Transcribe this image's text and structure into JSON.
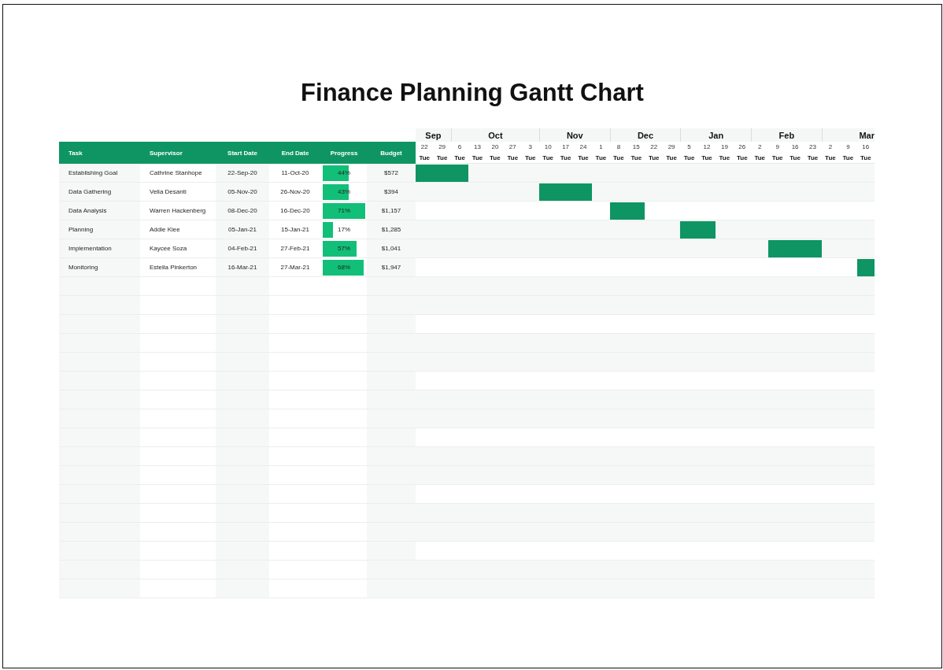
{
  "title": "Finance Planning Gantt Chart",
  "timeline": {
    "months": [
      {
        "label": "Sep",
        "weeks": [
          {
            "day": "22",
            "weekday": "Tue"
          },
          {
            "day": "29",
            "weekday": "Tue"
          }
        ]
      },
      {
        "label": "Oct",
        "weeks": [
          {
            "day": "6",
            "weekday": "Tue"
          },
          {
            "day": "13",
            "weekday": "Tue"
          },
          {
            "day": "20",
            "weekday": "Tue"
          },
          {
            "day": "27",
            "weekday": "Tue"
          },
          {
            "day": "3",
            "weekday": "Tue"
          }
        ]
      },
      {
        "label": "Nov",
        "weeks": [
          {
            "day": "10",
            "weekday": "Tue"
          },
          {
            "day": "17",
            "weekday": "Tue"
          },
          {
            "day": "24",
            "weekday": "Tue"
          },
          {
            "day": "1",
            "weekday": "Tue"
          }
        ]
      },
      {
        "label": "Dec",
        "weeks": [
          {
            "day": "8",
            "weekday": "Tue"
          },
          {
            "day": "15",
            "weekday": "Tue"
          },
          {
            "day": "22",
            "weekday": "Tue"
          },
          {
            "day": "29",
            "weekday": "Tue"
          }
        ]
      },
      {
        "label": "Jan",
        "weeks": [
          {
            "day": "5",
            "weekday": "Tue"
          },
          {
            "day": "12",
            "weekday": "Tue"
          },
          {
            "day": "19",
            "weekday": "Tue"
          },
          {
            "day": "26",
            "weekday": "Tue"
          }
        ]
      },
      {
        "label": "Feb",
        "weeks": [
          {
            "day": "2",
            "weekday": "Tue"
          },
          {
            "day": "9",
            "weekday": "Tue"
          },
          {
            "day": "16",
            "weekday": "Tue"
          },
          {
            "day": "23",
            "weekday": "Tue"
          }
        ]
      },
      {
        "label": "Mar",
        "weeks": [
          {
            "day": "2",
            "weekday": "Tue"
          },
          {
            "day": "9",
            "weekday": "Tue"
          },
          {
            "day": "16",
            "weekday": "Tue"
          }
        ]
      }
    ]
  },
  "table": {
    "columns": [
      "Task",
      "Supervisor",
      "Start Date",
      "End Date",
      "Progress",
      "Budget"
    ],
    "rows": [
      {
        "task": "Establishing Goal",
        "supervisor": "Cathrine Stanhope",
        "start_date": "22-Sep-20",
        "end_date": "11-Oct-20",
        "progress": {
          "label": "44%",
          "level": 0.62
        },
        "budget": "$572"
      },
      {
        "task": "Data Gathering",
        "supervisor": "Velia Desanti",
        "start_date": "05-Nov-20",
        "end_date": "26-Nov-20",
        "progress": {
          "label": "43%",
          "level": 0.61
        },
        "budget": "$394"
      },
      {
        "task": "Data Analysis",
        "supervisor": "Warren Hackenberg",
        "start_date": "08-Dec-20",
        "end_date": "16-Dec-20",
        "progress": {
          "label": "71%",
          "level": 1
        },
        "budget": "$1,157"
      },
      {
        "task": "Planning",
        "supervisor": "Addie Klee",
        "start_date": "05-Jan-21",
        "end_date": "15-Jan-21",
        "progress": {
          "label": "17%",
          "level": 0.24
        },
        "budget": "$1,285"
      },
      {
        "task": "Implementation",
        "supervisor": "Kaycee Soza",
        "start_date": "04-Feb-21",
        "end_date": "27-Feb-21",
        "progress": {
          "label": "57%",
          "level": 0.8
        },
        "budget": "$1,041"
      },
      {
        "task": "Monitoring",
        "supervisor": "Estella Pinkerton",
        "start_date": "16-Mar-21",
        "end_date": "27-Mar-21",
        "progress": {
          "label": "68%",
          "level": 0.96
        },
        "budget": "$1,947"
      }
    ]
  }
}
